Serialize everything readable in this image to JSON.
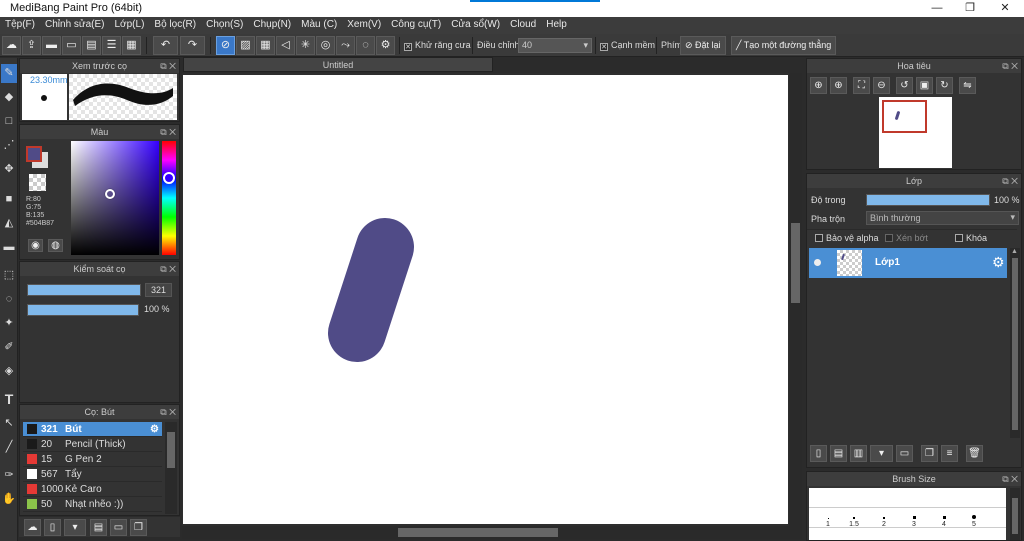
{
  "window": {
    "title": "MediBang Paint Pro (64bit)",
    "minimize": "—",
    "maximize": "❐",
    "close": "✕"
  },
  "menu": [
    "Tệp(F)",
    "Chỉnh sửa(E)",
    "Lớp(L)",
    "Bộ lọc(R)",
    "Chọn(S)",
    "Chụp(N)",
    "Màu (C)",
    "Xem(V)",
    "Công cụ(T)",
    "Cửa sổ(W)",
    "Cloud",
    "Help"
  ],
  "toolbar": {
    "antialias_label": "Khử răng cưa",
    "antialias_checked": true,
    "adjust_label": "Điều chỉnh",
    "adjust_value": "40",
    "smooth_label": "Cạnh mềm",
    "smooth_checked": true,
    "key_label": "Phím",
    "reset_label": "Đặt lại",
    "straight_label": "Tạo một đường thẳng"
  },
  "preview_panel": {
    "title": "Xem trước cọ",
    "size": "23.30mm"
  },
  "color_panel": {
    "title": "Màu",
    "r": "R:80",
    "g": "G:75",
    "b": "B:135",
    "hex": "#504B87",
    "main_color": "#504B87"
  },
  "brush_control": {
    "title": "Kiểm soát cọ",
    "size_value": "321",
    "opacity_value": "100 %",
    "size_fraction": 1.0,
    "opacity_fraction": 1.0
  },
  "brush_list": {
    "title": "Cọ: Bút",
    "items": [
      {
        "size": "321",
        "name": "Bút",
        "color": "#1a1a1a",
        "selected": true
      },
      {
        "size": "20",
        "name": "Pencil (Thick)",
        "color": "#1a1a1a",
        "selected": false
      },
      {
        "size": "15",
        "name": "G Pen 2",
        "color": "#e53935",
        "selected": false
      },
      {
        "size": "567",
        "name": "Tẩy",
        "color": "#ffffff",
        "selected": false
      },
      {
        "size": "1000",
        "name": "Kẻ Caro",
        "color": "#e53935",
        "selected": false
      },
      {
        "size": "50",
        "name": "Nhạt nhẽo :))",
        "color": "#8bc34a",
        "selected": false
      }
    ]
  },
  "canvas": {
    "tab_title": "Untitled",
    "stroke_color": "#504B87"
  },
  "navigator": {
    "title": "Hoa tiêu"
  },
  "layer_panel": {
    "title": "Lớp",
    "opacity_label": "Độ trong",
    "opacity_value": "100 %",
    "opacity_fraction": 1.0,
    "blend_label": "Pha trộn",
    "blend_value": "Bình thường",
    "protect_alpha": "Bảo vệ alpha",
    "clipping": "Xén bớt",
    "lock": "Khóa",
    "layers": [
      {
        "name": "Lớp1"
      }
    ]
  },
  "brush_size_panel": {
    "title": "Brush Size",
    "labels": [
      "1",
      "1.5",
      "2",
      "3",
      "4",
      "5"
    ]
  }
}
